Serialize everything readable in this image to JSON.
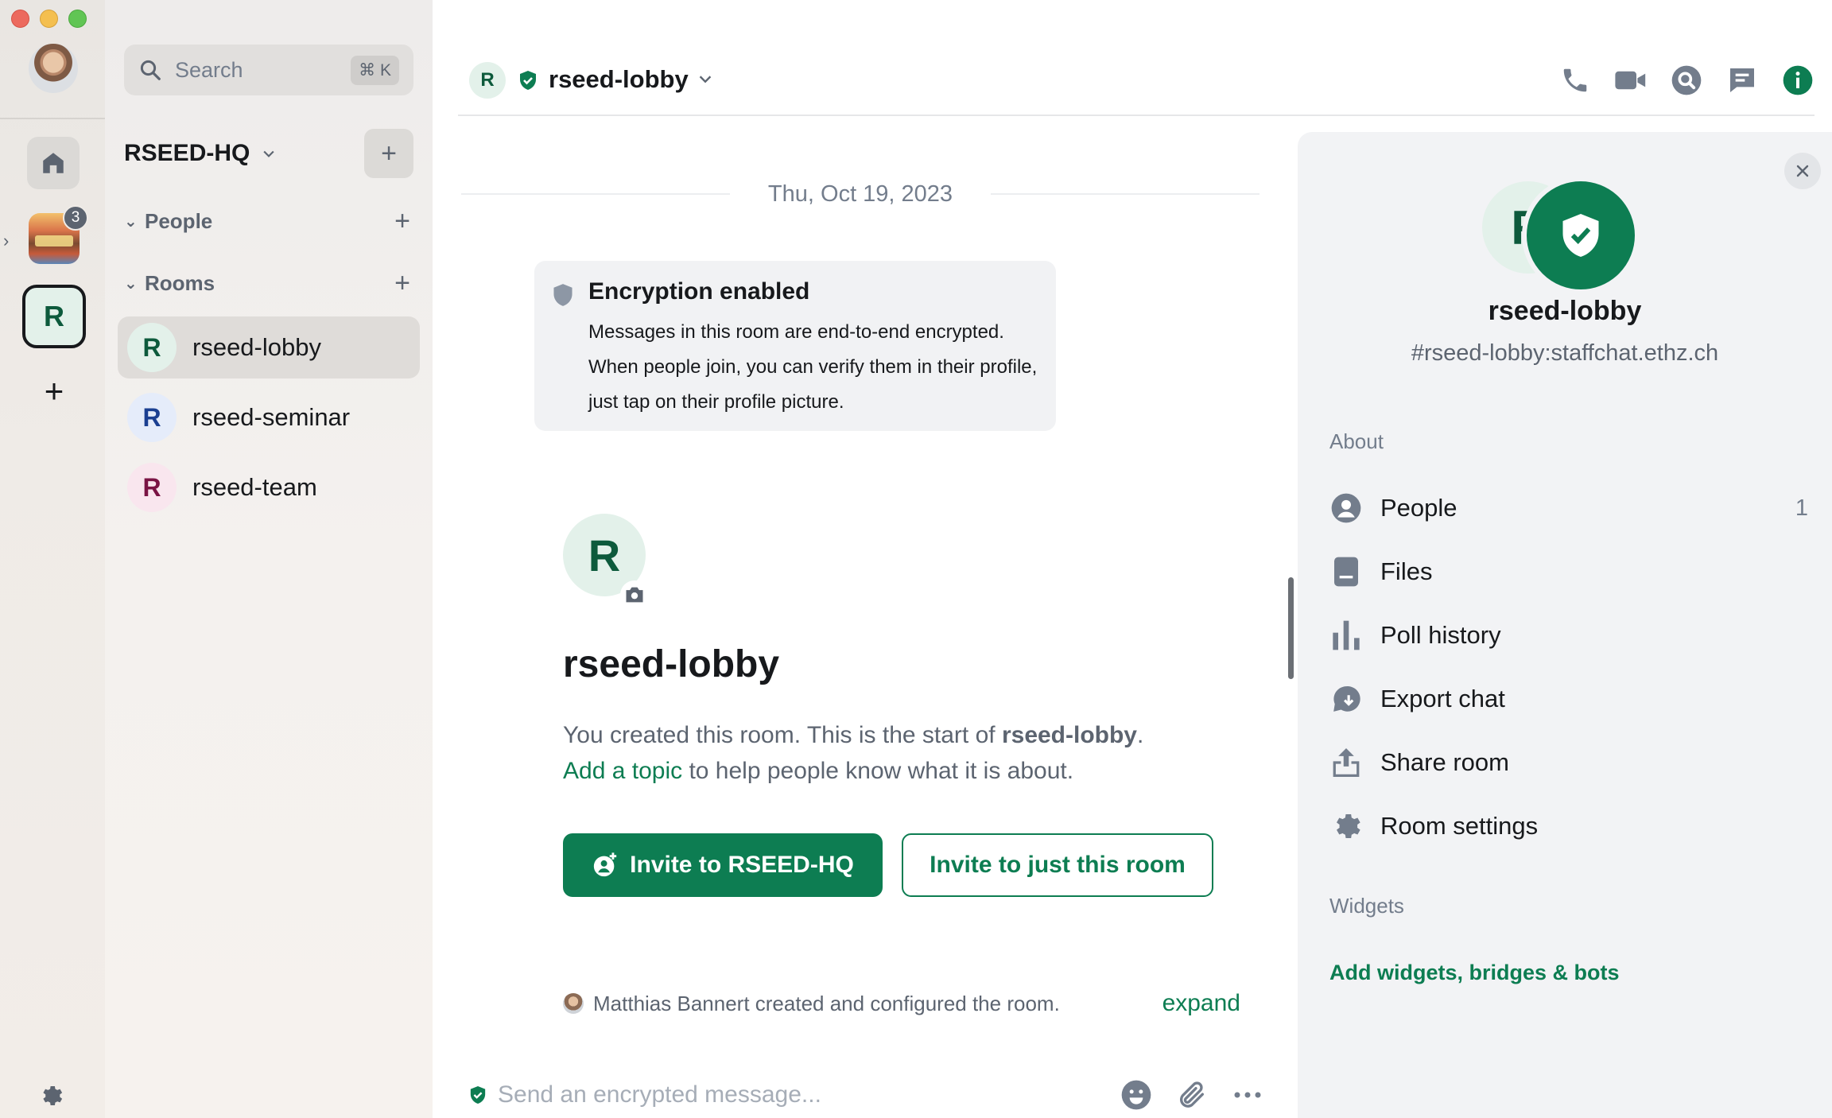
{
  "spacebar": {
    "hq_badge": "3",
    "r_space_letter": "R",
    "add_label": "+"
  },
  "roomlist": {
    "search_placeholder": "Search",
    "search_shortcut": "⌘ K",
    "space_name": "RSEED-HQ",
    "sections": [
      {
        "label": "People"
      },
      {
        "label": "Rooms"
      }
    ],
    "rooms": [
      {
        "letter": "R",
        "name": "rseed-lobby",
        "color": "#0d5a3c",
        "bg": "#e3f1ea"
      },
      {
        "letter": "R",
        "name": "rseed-seminar",
        "color": "#1b3f91",
        "bg": "#e5ecfa"
      },
      {
        "letter": "R",
        "name": "rseed-team",
        "color": "#7a1444",
        "bg": "#f9e6ee"
      }
    ]
  },
  "header": {
    "avatar_letter": "R",
    "title": "rseed-lobby"
  },
  "timeline": {
    "date": "Thu, Oct 19, 2023",
    "encryption": {
      "title": "Encryption enabled",
      "body": "Messages in this room are end-to-end encrypted. When people join, you can verify them in their profile, just tap on their profile picture."
    },
    "intro": {
      "avatar_letter": "R",
      "title": "rseed-lobby",
      "text_before": "You created this room. This is the start of ",
      "text_bold": "rseed-lobby",
      "text_after": ".",
      "link": "Add a topic",
      "text_link_after": " to help people know what it is about."
    },
    "invite_primary": "Invite to RSEED-HQ",
    "invite_secondary": "Invite to just this room",
    "created_summary": "Matthias Bannert created and configured the room.",
    "expand": "expand"
  },
  "composer": {
    "placeholder": "Send an encrypted message..."
  },
  "right_panel": {
    "avatar_letter": "R",
    "name": "rseed-lobby",
    "alias": "#rseed-lobby:staffchat.ethz.ch",
    "about_label": "About",
    "items": [
      {
        "label": "People",
        "count": "1"
      },
      {
        "label": "Files"
      },
      {
        "label": "Poll history"
      },
      {
        "label": "Export chat"
      },
      {
        "label": "Share room"
      },
      {
        "label": "Room settings"
      }
    ],
    "widgets_label": "Widgets",
    "widgets_link": "Add widgets, bridges & bots"
  },
  "colors": {
    "accent": "#0d7d52",
    "text_secondary": "#5c6470"
  }
}
